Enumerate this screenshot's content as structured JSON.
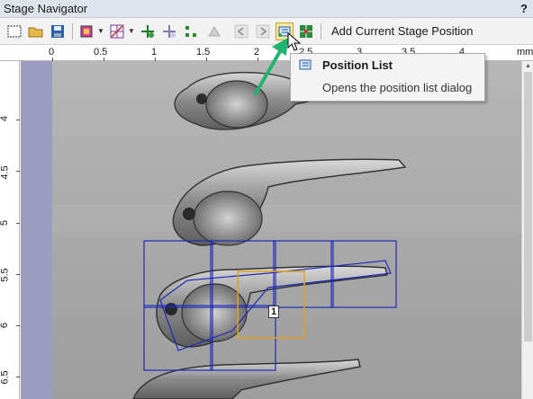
{
  "window": {
    "title": "Stage Navigator",
    "help_label": "?"
  },
  "toolbar": {
    "buttons": [
      {
        "name": "select-rect-icon"
      },
      {
        "name": "open-folder-icon"
      },
      {
        "name": "save-disk-icon"
      },
      {
        "name": "define-area-icon"
      },
      {
        "name": "define-grid-icon"
      },
      {
        "name": "add-point-icon"
      },
      {
        "name": "remove-point-icon"
      },
      {
        "name": "focus-points-icon"
      },
      {
        "name": "calibrate-icon"
      },
      {
        "name": "back-arrow-icon"
      },
      {
        "name": "forward-arrow-icon"
      },
      {
        "name": "position-list-icon"
      },
      {
        "name": "stage-crosshair-icon"
      }
    ],
    "add_position_label": "Add Current Stage Position"
  },
  "ruler": {
    "unit": "mm",
    "x_ticks": [
      "0",
      "0.5",
      "1",
      "1.5",
      "2",
      "2.5",
      "3",
      "3.5",
      "4"
    ],
    "y_ticks": [
      "4",
      "4.5",
      "5",
      "5.5",
      "6",
      "6.5"
    ]
  },
  "tooltip": {
    "title": "Position List",
    "description": "Opens the position list dialog"
  },
  "overlay": {
    "position_number": "1",
    "tile_color": "#1f2bb8",
    "selection_color": "#e0a21a",
    "annotation_arrow_color": "#1fb571"
  }
}
